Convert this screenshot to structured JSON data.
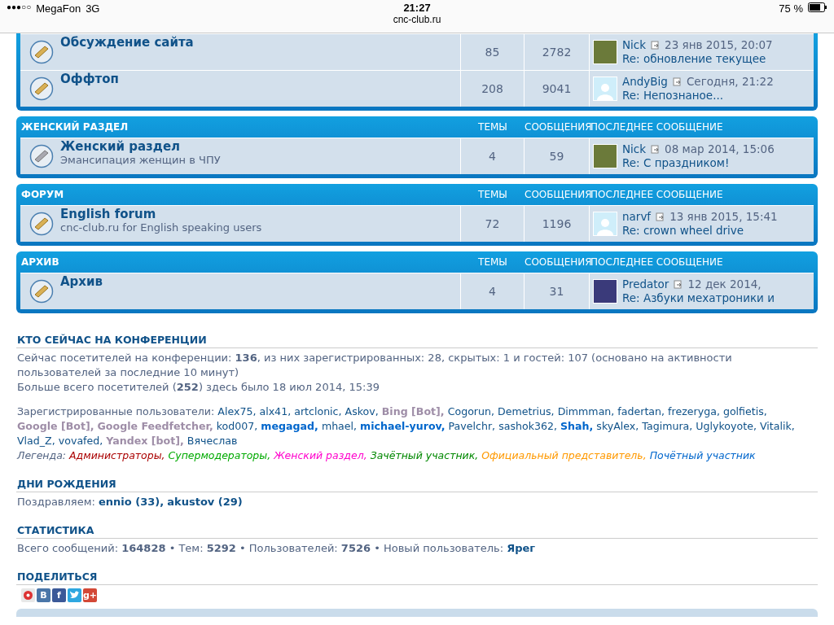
{
  "status_bar": {
    "signal": "●●●○○",
    "carrier": "MegaFon",
    "network": "3G",
    "time": "21:27",
    "url": "cnc-club.ru",
    "battery": "75 %"
  },
  "sections": [
    {
      "forums": [
        {
          "name": "Обсуждение сайта",
          "read": false,
          "topics": "85",
          "posts": "2782",
          "last": {
            "author": "Nick",
            "avatar": {
              "kind": "photo"
            },
            "date": "23 янв 2015, 20:07",
            "subject": "Re: обновление текущее"
          }
        },
        {
          "name": "Оффтоп",
          "read": false,
          "topics": "208",
          "posts": "9041",
          "last": {
            "author": "AndyBig",
            "avatar": {
              "kind": "blank"
            },
            "date": "Сегодня, 21:22",
            "subject": "Re: Непознаное..."
          }
        }
      ]
    },
    {
      "title": "ЖЕНСКИЙ РАЗДЕЛ",
      "columns": [
        "ТЕМЫ",
        "СООБЩЕНИЯ",
        "ПОСЛЕДНЕЕ СООБЩЕНИЕ"
      ],
      "forums": [
        {
          "name": "Женский раздел",
          "description": "Эмансипация женщин в ЧПУ",
          "read": true,
          "topics": "4",
          "posts": "59",
          "last": {
            "author": "Nick",
            "avatar": {
              "kind": "photo"
            },
            "date": "08 мар 2014, 15:06",
            "subject": "Re: С праздником!"
          }
        }
      ]
    },
    {
      "title": "ФОРУМ",
      "columns": [
        "ТЕМЫ",
        "СООБЩЕНИЯ",
        "ПОСЛЕДНЕЕ СООБЩЕНИЕ"
      ],
      "forums": [
        {
          "name": "English forum",
          "description": "cnc-club.ru for English speaking users",
          "read": false,
          "topics": "72",
          "posts": "1196",
          "last": {
            "author": "narvf",
            "avatar": {
              "kind": "blank"
            },
            "date": "13 янв 2015, 15:41",
            "subject": "Re: crown wheel drive"
          }
        }
      ]
    },
    {
      "title": "АРХИВ",
      "columns": [
        "ТЕМЫ",
        "СООБЩЕНИЯ",
        "ПОСЛЕДНЕЕ СООБЩЕНИЕ"
      ],
      "forums": [
        {
          "name": "Архив",
          "read": false,
          "topics": "4",
          "posts": "31",
          "last": {
            "author": "Predator",
            "avatar": {
              "kind": "image"
            },
            "date": "12 дек 2014,",
            "subject": "Re: Азбуки мехатроники и"
          }
        }
      ]
    }
  ],
  "online": {
    "title": "КТО СЕЙЧАС НА КОНФЕРЕНЦИИ",
    "summary": "Сейчас посетителей на конференции: **136**, из них зарегистрированных: 28, скрытых: 1 и гостей: 107 (основано на активности пользователей за последние 10 минут)",
    "record": "Больше всего посетителей (**252**) здесь было 18 июл 2014, 15:39",
    "users_label": "Зарегистрированные пользователи:",
    "users": [
      {
        "name": "Alex75,",
        "kind": "user"
      },
      {
        "name": "alx41,",
        "kind": "user"
      },
      {
        "name": "artclonic,",
        "kind": "user"
      },
      {
        "name": "Askov,",
        "kind": "user"
      },
      {
        "name": "Bing [Bot],",
        "kind": "bot"
      },
      {
        "name": "Cogorun,",
        "kind": "user"
      },
      {
        "name": "Demetrius,",
        "kind": "user"
      },
      {
        "name": "Dimmman,",
        "kind": "user"
      },
      {
        "name": "fadertan,",
        "kind": "user"
      },
      {
        "name": "frezeryga,",
        "kind": "user"
      },
      {
        "name": "golfietis,",
        "kind": "user"
      },
      {
        "name": "Google [Bot],",
        "kind": "bot"
      },
      {
        "name": "Google Feedfetcher,",
        "kind": "bot"
      },
      {
        "name": "kod007,",
        "kind": "user"
      },
      {
        "name": "megagad,",
        "kind": "honored"
      },
      {
        "name": "mhael,",
        "kind": "user"
      },
      {
        "name": "michael-yurov,",
        "kind": "honored"
      },
      {
        "name": "Pavelchr,",
        "kind": "user"
      },
      {
        "name": "sashok362,",
        "kind": "user"
      },
      {
        "name": "Shah,",
        "kind": "honored"
      },
      {
        "name": "skyAlex,",
        "kind": "user"
      },
      {
        "name": "Tagimura,",
        "kind": "user"
      },
      {
        "name": "Uglykoyote,",
        "kind": "user"
      },
      {
        "name": "Vitalik,",
        "kind": "user"
      },
      {
        "name": "Vlad_Z,",
        "kind": "user"
      },
      {
        "name": "vovafed,",
        "kind": "user"
      },
      {
        "name": "Yandex [bot],",
        "kind": "bot"
      },
      {
        "name": "Вячеслав",
        "kind": "user"
      }
    ],
    "legend_label": "Легенда:",
    "legend": [
      {
        "name": "Администраторы,",
        "color": "#aa0000"
      },
      {
        "name": "Супермодераторы,",
        "color": "#00aa00"
      },
      {
        "name": "Женский раздел,",
        "color": "#ff00cc"
      },
      {
        "name": "Зачётный участник,",
        "color": "#008800"
      },
      {
        "name": "Официальный представитель,",
        "color": "#ff9900"
      },
      {
        "name": "Почётный участник",
        "color": "#0066cc"
      }
    ]
  },
  "birthdays": {
    "title": "ДНИ РОЖДЕНИЯ",
    "label": "Поздравляем:",
    "people": [
      "ennio (33),",
      "akustov (29)"
    ]
  },
  "statistics": {
    "title": "СТАТИСТИКА",
    "text": "Всего сообщений: **164828** • Тем: **5292** • Пользователей: **7526** • Новый пользователь:",
    "newest": "Ярег"
  },
  "share": {
    "title": "ПОДЕЛИТЬСЯ",
    "services": [
      {
        "kind": "mail"
      },
      {
        "kind": "vk",
        "label": "B"
      },
      {
        "kind": "facebook",
        "label": "f"
      },
      {
        "kind": "twitter"
      },
      {
        "kind": "gplus",
        "label": "g+"
      }
    ]
  }
}
